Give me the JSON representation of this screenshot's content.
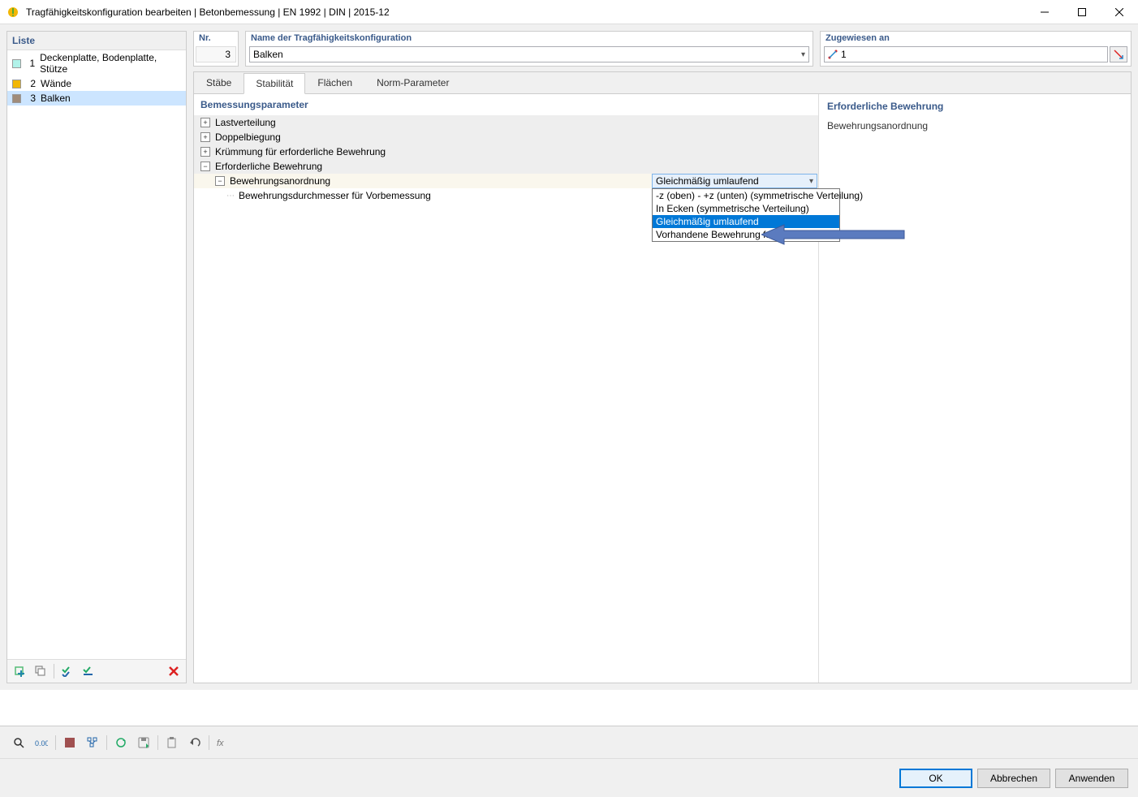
{
  "window": {
    "title": "Tragfähigkeitskonfiguration bearbeiten | Betonbemessung | EN 1992 | DIN | 2015-12"
  },
  "leftPanel": {
    "header": "Liste",
    "items": [
      {
        "num": "1",
        "label": "Deckenplatte, Bodenplatte, Stütze",
        "color": "#b1f2e9"
      },
      {
        "num": "2",
        "label": "Wände",
        "color": "#f2b705"
      },
      {
        "num": "3",
        "label": "Balken",
        "color": "#a08c7a"
      }
    ]
  },
  "topRow": {
    "nrLabel": "Nr.",
    "nrValue": "3",
    "nameLabel": "Name der Tragfähigkeitskonfiguration",
    "nameValue": "Balken",
    "assignLabel": "Zugewiesen an",
    "assignValue": "1"
  },
  "tabs": [
    "Stäbe",
    "Stabilität",
    "Flächen",
    "Norm-Parameter"
  ],
  "activeTab": 1,
  "params": {
    "header": "Bemessungsparameter",
    "rows": [
      {
        "type": "group",
        "exp": "+",
        "label": "Lastverteilung"
      },
      {
        "type": "group",
        "exp": "+",
        "label": "Doppelbiegung"
      },
      {
        "type": "group",
        "exp": "+",
        "label": "Krümmung für erforderliche Bewehrung"
      },
      {
        "type": "group",
        "exp": "-",
        "label": "Erforderliche Bewehrung"
      },
      {
        "type": "sub",
        "exp": "-",
        "indent": 1,
        "label": "Bewehrungsanordnung",
        "dropdown": true
      },
      {
        "type": "leaf",
        "indent": 2,
        "label": "Bewehrungsdurchmesser für Vorbemessung"
      }
    ],
    "dropdown": {
      "selected": "Gleichmäßig umlaufend",
      "options": [
        "-z (oben) - +z (unten) (symmetrische Verteilung)",
        "In Ecken (symmetrische Verteilung)",
        "Gleichmäßig umlaufend",
        "Vorhandene Bewehrung faktorisieren"
      ],
      "highlight": 2
    }
  },
  "rightCol": {
    "header": "Erforderliche Bewehrung",
    "text": "Bewehrungsanordnung"
  },
  "buttons": {
    "ok": "OK",
    "cancel": "Abbrechen",
    "apply": "Anwenden"
  }
}
